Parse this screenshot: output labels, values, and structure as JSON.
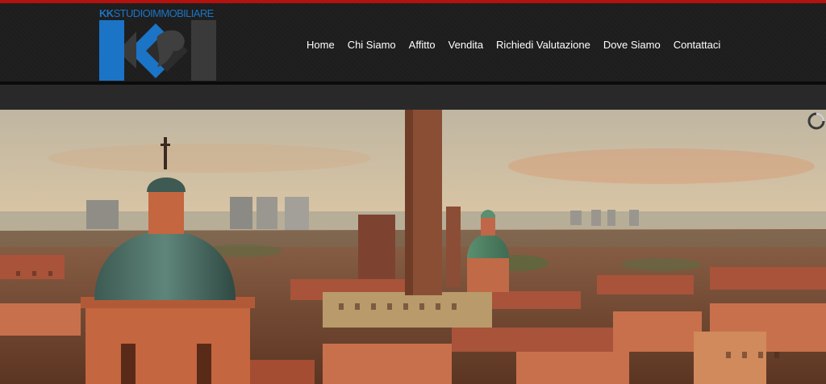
{
  "brand": {
    "part1": "KK",
    "part2": "STUDIO",
    "part3": "IMMOBILIARE",
    "colors": {
      "blue": "#1b74c6",
      "gray": "#3a3a3a",
      "accent": "#b3120e"
    }
  },
  "nav": {
    "items": [
      {
        "label": "Home"
      },
      {
        "label": "Chi Siamo"
      },
      {
        "label": "Affitto"
      },
      {
        "label": "Vendita"
      },
      {
        "label": "Richiedi Valutazione"
      },
      {
        "label": "Dove Siamo"
      },
      {
        "label": "Contattaci"
      }
    ]
  },
  "hero": {
    "icon": "loading-spinner-icon"
  }
}
